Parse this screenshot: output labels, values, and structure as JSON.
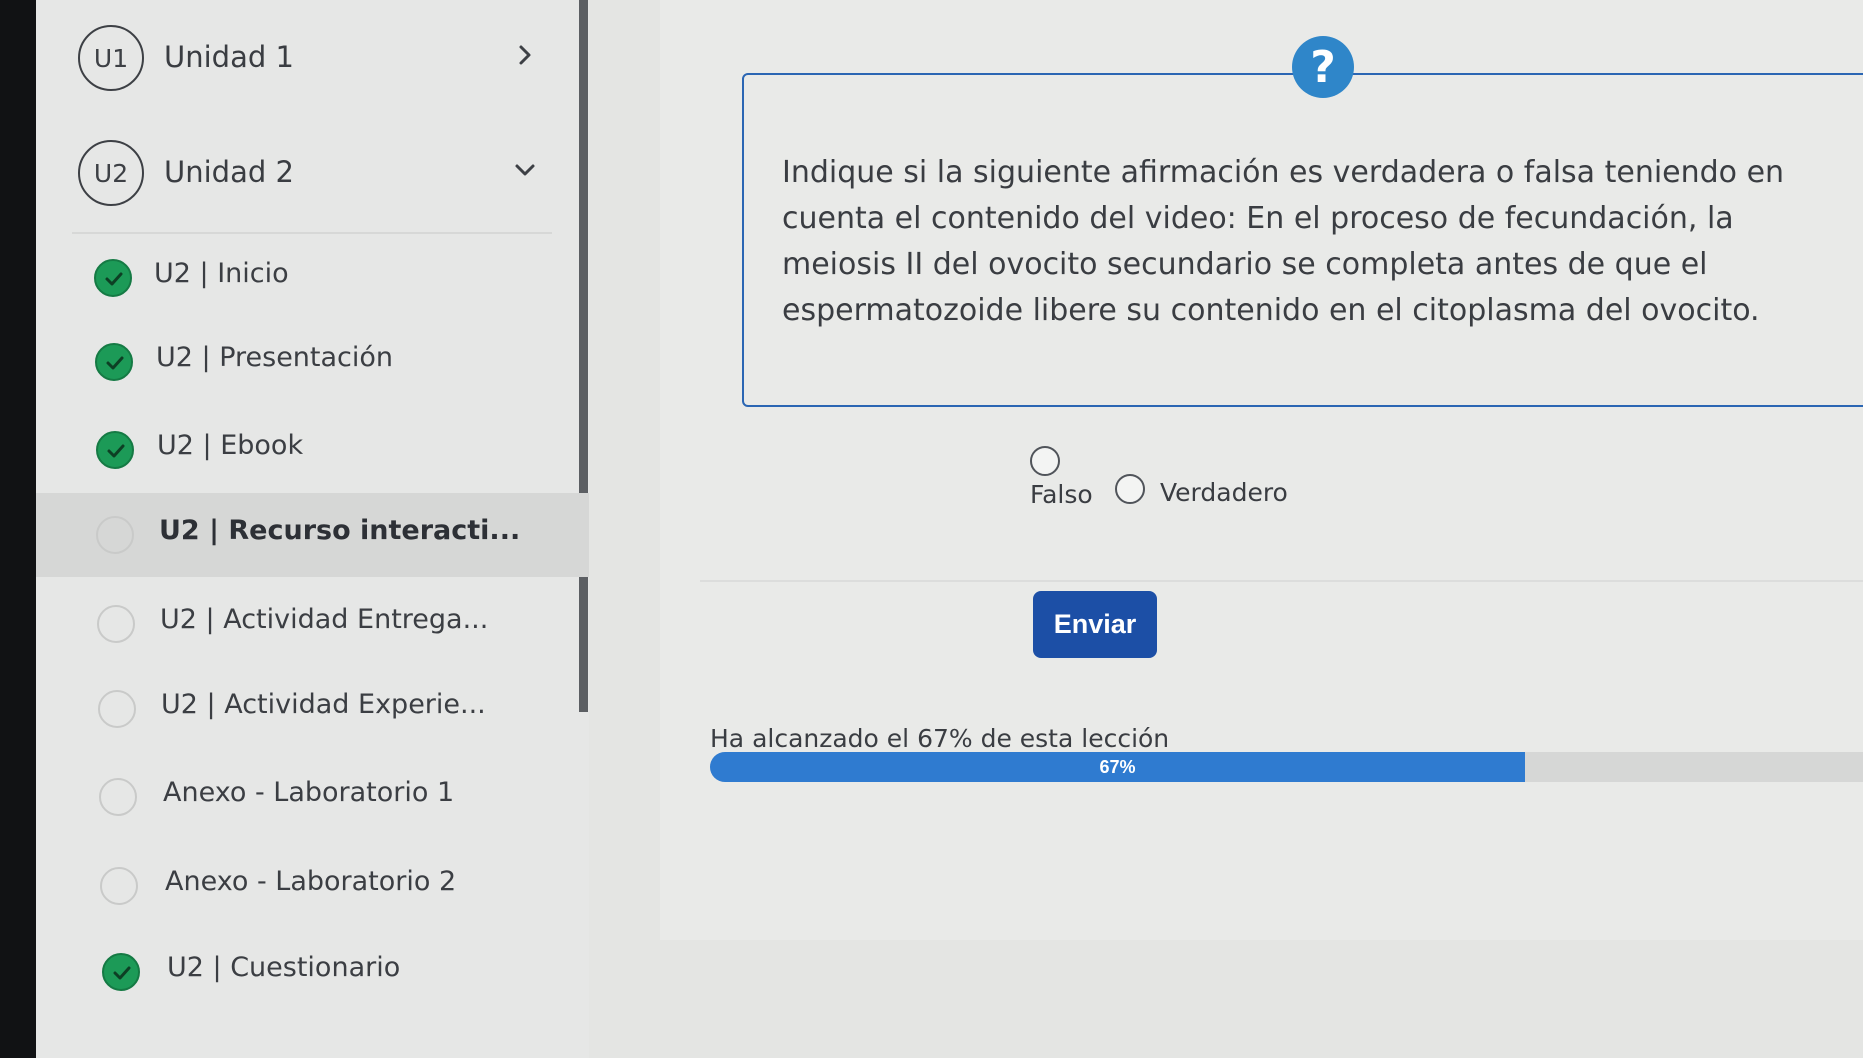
{
  "sidebar": {
    "units": [
      {
        "badge": "U1",
        "title": "Unidad 1",
        "state": "collapsed"
      },
      {
        "badge": "U2",
        "title": "Unidad 2",
        "state": "expanded"
      }
    ],
    "lessons": [
      {
        "label": "U2 | Inicio",
        "completed": true
      },
      {
        "label": "U2 | Presentación",
        "completed": true
      },
      {
        "label": "U2 | Ebook",
        "completed": true
      },
      {
        "label": "U2 | Recurso interacti...",
        "completed": false,
        "active": true
      },
      {
        "label": "U2 | Actividad Entrega...",
        "completed": false
      },
      {
        "label": "U2 | Actividad Experie...",
        "completed": false
      },
      {
        "label": "Anexo - Laboratorio 1",
        "completed": false
      },
      {
        "label": "Anexo - Laboratorio 2",
        "completed": false
      },
      {
        "label": "U2 | Cuestionario",
        "completed": true
      }
    ]
  },
  "question": {
    "icon": "question-icon",
    "icon_glyph": "?",
    "text": "Indique si la siguiente afirmación es verdadera o falsa teniendo en cuenta el contenido del video: En el proceso de fecundación, la meiosis II del ovocito secundario se completa antes de que el espermatozoide libere su contenido en el citoplasma del ovocito.",
    "options": [
      {
        "label": "Falso",
        "selected": false
      },
      {
        "label": "Verdadero",
        "selected": false
      }
    ],
    "submit_label": "Enviar"
  },
  "progress": {
    "text": "Ha alcanzado el 67% de esta lección",
    "value_label": "67%",
    "fraction": 0.67
  },
  "colors": {
    "accent_blue": "#1c4fa6",
    "progress_blue": "#2f7bd0",
    "completed_green": "#1c9a57"
  }
}
